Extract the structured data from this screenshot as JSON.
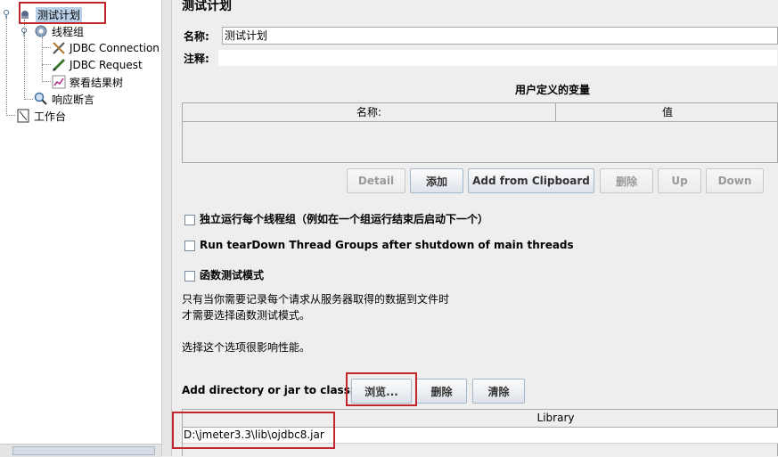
{
  "tree": {
    "root": "测试计划",
    "thread_group": "线程组",
    "jdbc_connection": "JDBC Connection",
    "jdbc_request": "JDBC Request",
    "result_tree": "察看结果树",
    "assertion": "响应断言",
    "workbench": "工作台"
  },
  "panel": {
    "title": "测试计划",
    "name_label": "名称:",
    "name_value": "测试计划",
    "comment_label": "注释:",
    "comment_value": "",
    "variables_title": "用户定义的变量",
    "table_headers": [
      "名称:",
      "值"
    ],
    "buttons": {
      "detail": "Detail",
      "add": "添加",
      "add_clipboard": "Add from Clipboard",
      "delete": "删除",
      "up": "Up",
      "down": "Down"
    },
    "checkboxes": [
      "独立运行每个线程组（例如在一个组运行结束后启动下一个）",
      "Run tearDown Thread Groups after shutdown of main threads",
      "函数测试模式"
    ],
    "help_lines": [
      "只有当你需要记录每个请求从服务器取得的数据到文件时",
      "才需要选择函数测试模式。",
      "选择这个选项很影响性能。"
    ],
    "classpath_label": "Add directory or jar to classpath",
    "browse_button": "浏览...",
    "cp_delete_button": "删除",
    "clear_button": "清除",
    "library_header": "Library",
    "library_entries": [
      "D:\\jmeter3.3\\lib\\ojdbc8.jar"
    ]
  },
  "colors": {
    "highlight": "#c0262c",
    "selection": "#b8cfe5",
    "button_border": "#a3b8cc"
  }
}
